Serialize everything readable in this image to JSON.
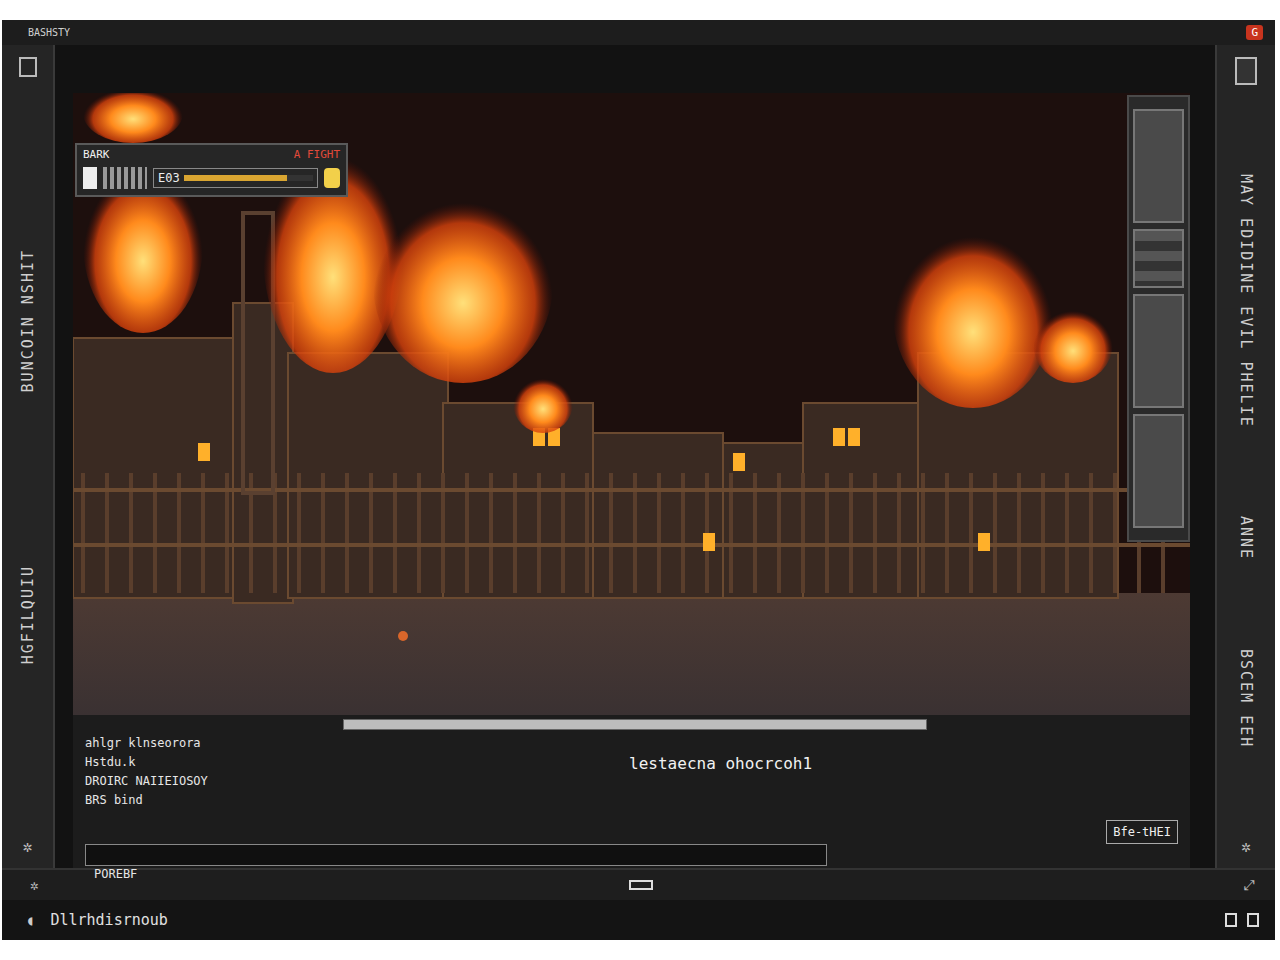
{
  "window": {
    "title": "BASHSTY",
    "close": "G"
  },
  "left_rail": {
    "labels": [
      "BUNCOIN NSHIT",
      "HGFILQUIU"
    ]
  },
  "right_rail": {
    "labels": [
      "MAY EDIDINE EVIL PHELIE",
      "ANNE",
      "BSCEM EEH"
    ]
  },
  "hud": {
    "name": "BARK",
    "badge": "A FIGHT",
    "score": "E03",
    "level": 0.8
  },
  "slots": [
    {
      "kind": "large"
    },
    {
      "kind": "small"
    },
    {
      "kind": "large"
    },
    {
      "kind": "large"
    }
  ],
  "dialog": {
    "progress": 1.0,
    "lines": [
      "ahlgr klnseorora",
      "Hstdu.k",
      "DROIRC NAIIEIOSOY",
      "BRS bind"
    ],
    "input": "POREBF",
    "message": "lestaecna ohocrcoh1",
    "button": "Bfe-tHEI"
  },
  "status_bar": {
    "text": "Dllrhdisrnoub"
  }
}
